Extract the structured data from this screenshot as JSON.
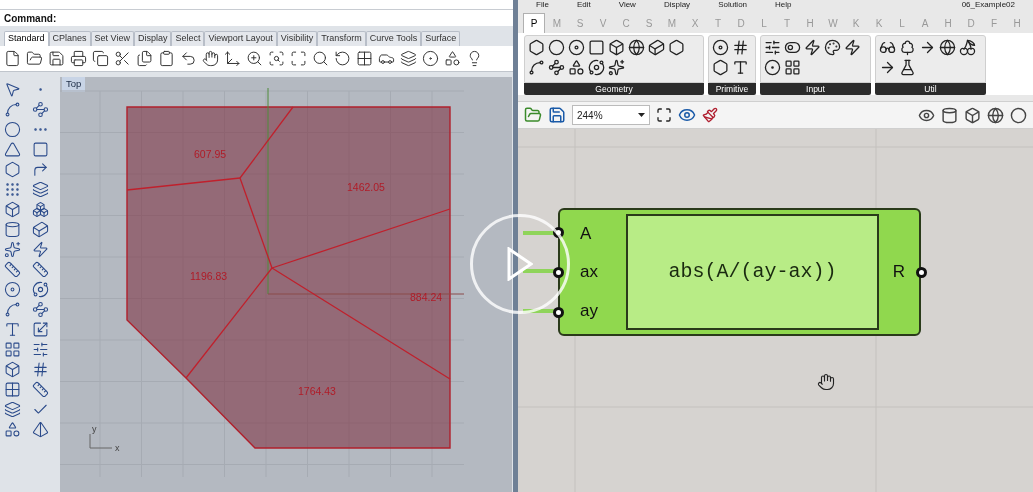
{
  "command_line": {
    "label": "Command:"
  },
  "toolbar_tabs": [
    {
      "label": "Standard",
      "selected": true
    },
    {
      "label": "CPlanes",
      "selected": false
    },
    {
      "label": "Set View",
      "selected": false
    },
    {
      "label": "Display",
      "selected": false
    },
    {
      "label": "Select",
      "selected": false
    },
    {
      "label": "Viewport Layout",
      "selected": false
    },
    {
      "label": "Visibility",
      "selected": false
    },
    {
      "label": "Transform",
      "selected": false
    },
    {
      "label": "Curve Tools",
      "selected": false
    },
    {
      "label": "Surface",
      "selected": false
    }
  ],
  "viewport": {
    "title": "Top",
    "area_labels": [
      "607.95",
      "1462.05",
      "1196.83",
      "884.24",
      "1764.43"
    ],
    "axis_labels": [
      "y",
      "x"
    ]
  },
  "gh_menu": [
    "File",
    "Edit",
    "View",
    "Display",
    "Solution",
    "Help"
  ],
  "document_title": "06_Example02",
  "gh_tabs": [
    {
      "label": "P",
      "selected": true
    },
    {
      "label": "M",
      "selected": false
    },
    {
      "label": "S",
      "selected": false
    },
    {
      "label": "V",
      "selected": false
    },
    {
      "label": "C",
      "selected": false
    },
    {
      "label": "S",
      "selected": false
    },
    {
      "label": "M",
      "selected": false
    },
    {
      "label": "X",
      "selected": false
    },
    {
      "label": "T",
      "selected": false
    },
    {
      "label": "D",
      "selected": false
    },
    {
      "label": "L",
      "selected": false
    },
    {
      "label": "T",
      "selected": false
    },
    {
      "label": "H",
      "selected": false
    },
    {
      "label": "W",
      "selected": false
    },
    {
      "label": "K",
      "selected": false
    },
    {
      "label": "K",
      "selected": false
    },
    {
      "label": "L",
      "selected": false
    },
    {
      "label": "A",
      "selected": false
    },
    {
      "label": "H",
      "selected": false
    },
    {
      "label": "D",
      "selected": false
    },
    {
      "label": "F",
      "selected": false
    },
    {
      "label": "H",
      "selected": false
    }
  ],
  "ribbon_groups": [
    {
      "label": "Geometry"
    },
    {
      "label": "Primitive"
    },
    {
      "label": "Input"
    },
    {
      "label": "Util"
    }
  ],
  "zoom_field": {
    "value": "244%"
  },
  "component": {
    "inputs": [
      "A",
      "ax",
      "ay"
    ],
    "expression": "abs(A/(ay-ax))",
    "outputs": [
      "R"
    ]
  }
}
